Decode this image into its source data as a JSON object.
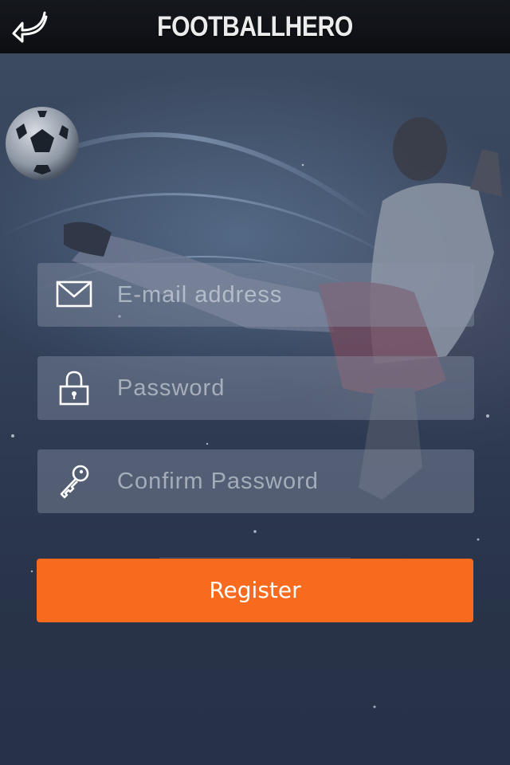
{
  "header": {
    "title": "FOOTBALLHERO",
    "back_icon": "back-arrow-icon"
  },
  "form": {
    "email": {
      "placeholder": "E-mail address",
      "value": "",
      "icon": "envelope-icon"
    },
    "password": {
      "placeholder": "Password",
      "value": "",
      "icon": "lock-icon"
    },
    "confirm_password": {
      "placeholder": "Confirm Password",
      "value": "",
      "icon": "key-icon"
    },
    "register_label": "Register"
  },
  "colors": {
    "accent": "#f86b1f",
    "header_bg": "#111419",
    "background": "#2a3446"
  }
}
